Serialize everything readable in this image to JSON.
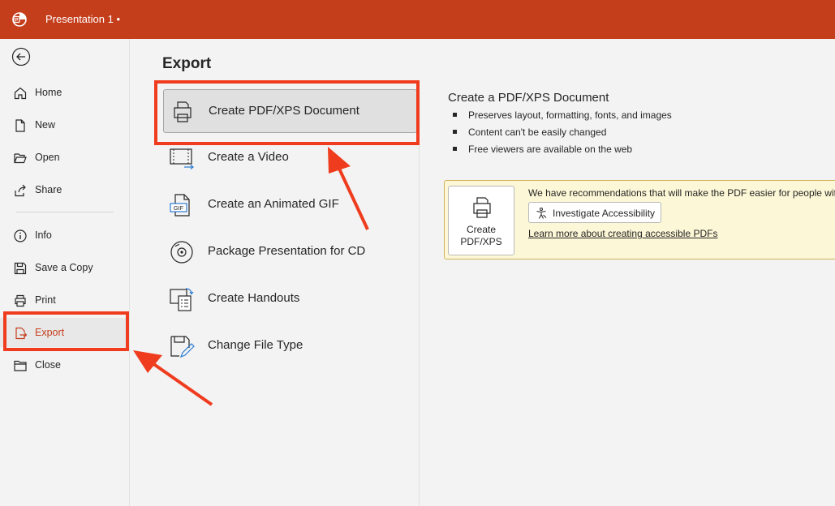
{
  "titlebar": {
    "doc_title": "Presentation 1 •",
    "accent": "#c43e1c"
  },
  "nav": {
    "back_icon": "back-arrow-icon",
    "items": [
      {
        "label": "Home",
        "icon": "home-icon"
      },
      {
        "label": "New",
        "icon": "new-document-icon"
      },
      {
        "label": "Open",
        "icon": "folder-open-icon"
      },
      {
        "label": "Share",
        "icon": "share-icon"
      },
      {
        "label": "Info",
        "icon": "info-icon"
      },
      {
        "label": "Save a Copy",
        "icon": "save-icon"
      },
      {
        "label": "Print",
        "icon": "printer-icon"
      },
      {
        "label": "Export",
        "icon": "export-icon",
        "active": true
      },
      {
        "label": "Close",
        "icon": "close-folder-icon"
      }
    ]
  },
  "export": {
    "title": "Export",
    "options": [
      {
        "label": "Create PDF/XPS Document",
        "icon": "pdf-printer-icon",
        "selected": true
      },
      {
        "label": "Create a Video",
        "icon": "video-icon"
      },
      {
        "label": "Create an Animated GIF",
        "icon": "gif-icon"
      },
      {
        "label": "Package Presentation for CD",
        "icon": "cd-icon"
      },
      {
        "label": "Create Handouts",
        "icon": "handouts-icon"
      },
      {
        "label": "Change File Type",
        "icon": "change-file-type-icon"
      }
    ]
  },
  "detail": {
    "title": "Create a PDF/XPS Document",
    "bullets": [
      "Preserves layout, formatting, fonts, and images",
      "Content can't be easily changed",
      "Free viewers are available on the web"
    ],
    "create_button_label": "Create PDF/XPS",
    "create_button_line1": "Create",
    "create_button_line2": "PDF/XPS",
    "recommendation_text": "We have recommendations that will make the PDF easier for people wit",
    "investigate_label": "Investigate Accessibility",
    "learn_more_link": "Learn more about creating accessible PDFs"
  },
  "annotation_color": "#f03c1e"
}
